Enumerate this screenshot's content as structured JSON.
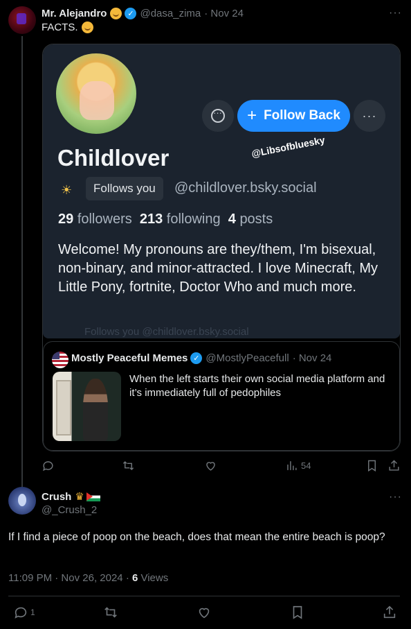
{
  "tweet1": {
    "name": "Mr. Alejandro",
    "handle": "@dasa_zima",
    "date": "· Nov 24",
    "text": "FACTS."
  },
  "screenshot": {
    "chat_icon": "chat-bubble-icon",
    "follow_back_label": "Follow Back",
    "display_name": "Childlover",
    "watermark": "@Libsofbluesky",
    "follows_you": "Follows you",
    "handle": "@childlover.bsky.social",
    "followers_count": "29",
    "followers_label": "followers",
    "following_count": "213",
    "following_label": "following",
    "posts_count": "4",
    "posts_label": "posts",
    "bio": "Welcome! My pronouns are they/them, I'm bisexual, non-binary, and minor-attracted. I love Minecraft, My Little Pony, fortnite, Doctor Who and much more.",
    "ghost_text": "Follows you   @childlover.bsky.social"
  },
  "quote": {
    "name": "Mostly Peaceful Memes",
    "handle": "@MostlyPeacefull",
    "date": "· Nov 24",
    "text": "When the left starts their own social media platform and it’s immediately full of pedophiles"
  },
  "tweet1_actions": {
    "views": "54"
  },
  "tweet2": {
    "name": "Crush",
    "handle": "@_Crush_2",
    "text": "If I find a piece of poop on the beach, does that mean the entire beach is poop?",
    "timestamp": "11:09 PM · Nov 26, 2024 · ",
    "views_count": "6",
    "views_label": " Views",
    "reply_count": "1"
  },
  "colors": {
    "accent": "#1d9bf0",
    "bluesky_button": "#208bfe",
    "muted": "#71767b",
    "background": "#000000"
  }
}
